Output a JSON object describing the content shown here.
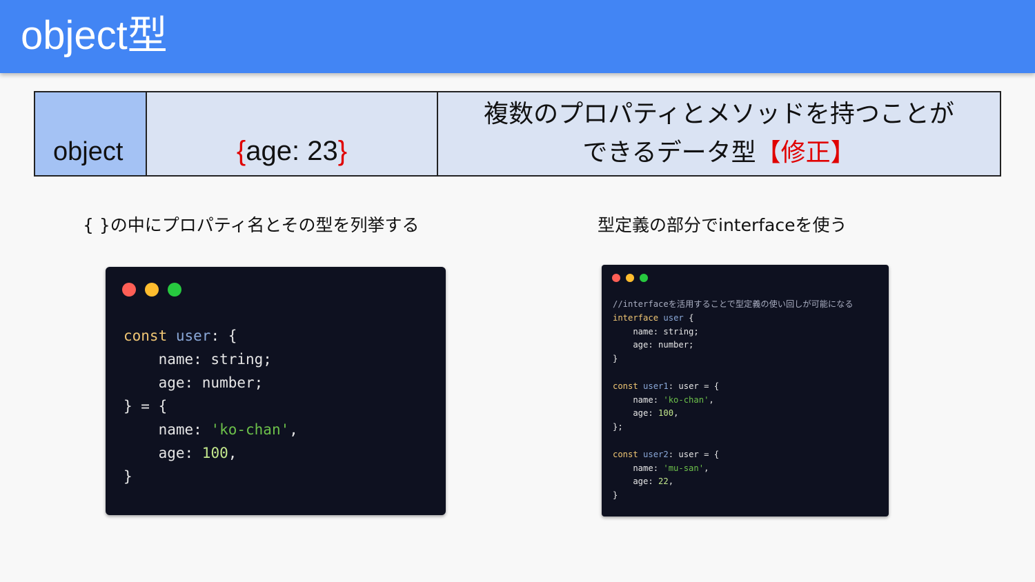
{
  "slide": {
    "title": "object型"
  },
  "table": {
    "type_name": "object",
    "example_open": "{",
    "example_body": "age: 23",
    "example_close": "}",
    "description_line1": "複数のプロパティとメソッドを持つことが",
    "description_line2": "できるデータ型",
    "correction_note": "【修正】"
  },
  "captions": {
    "left": "{ }の中にプロパティ名とその型を列挙する",
    "right": "型定義の部分でinterfaceを使う"
  },
  "code_left": {
    "lines": [
      {
        "kw": "const",
        "sp1": " ",
        "var": "user",
        "rest": ": {"
      },
      {
        "text": "    name: string;"
      },
      {
        "text": "    age: number;"
      },
      {
        "text": "} = {"
      },
      {
        "pre": "    name: ",
        "str": "'ko-chan'",
        "post": ","
      },
      {
        "pre": "    age: ",
        "num": "100",
        "post": ","
      },
      {
        "text": "}"
      }
    ]
  },
  "code_right": {
    "comment": "//interfaceを活用することで型定義の使い回しが可能になる",
    "iface_kw": "interface",
    "iface_name": "user",
    "iface_open": " {",
    "iface_name_line": "    name: string;",
    "iface_age_line": "    age: number;",
    "iface_close": "}",
    "u1_kw": "const",
    "u1_var": "user1",
    "u1_rest": ": user = {",
    "u1_name_pre": "    name: ",
    "u1_name_val": "'ko-chan'",
    "u1_name_post": ",",
    "u1_age_pre": "    age: ",
    "u1_age_val": "100",
    "u1_age_post": ",",
    "u1_close": "};",
    "u2_kw": "const",
    "u2_var": "user2",
    "u2_rest": ": user = {",
    "u2_name_pre": "    name: ",
    "u2_name_val": "'mu-san'",
    "u2_name_post": ",",
    "u2_age_pre": "    age: ",
    "u2_age_val": "22",
    "u2_age_post": ",",
    "u2_close": "}"
  },
  "colors": {
    "title_bar": "#4285f4",
    "table_header_cell": "#a4c2f4",
    "table_cell": "#dae3f3",
    "correction_red": "#e00000",
    "code_bg": "#0e1120"
  },
  "icons": [
    "window-close-dot-icon",
    "window-minimize-dot-icon",
    "window-maximize-dot-icon"
  ]
}
